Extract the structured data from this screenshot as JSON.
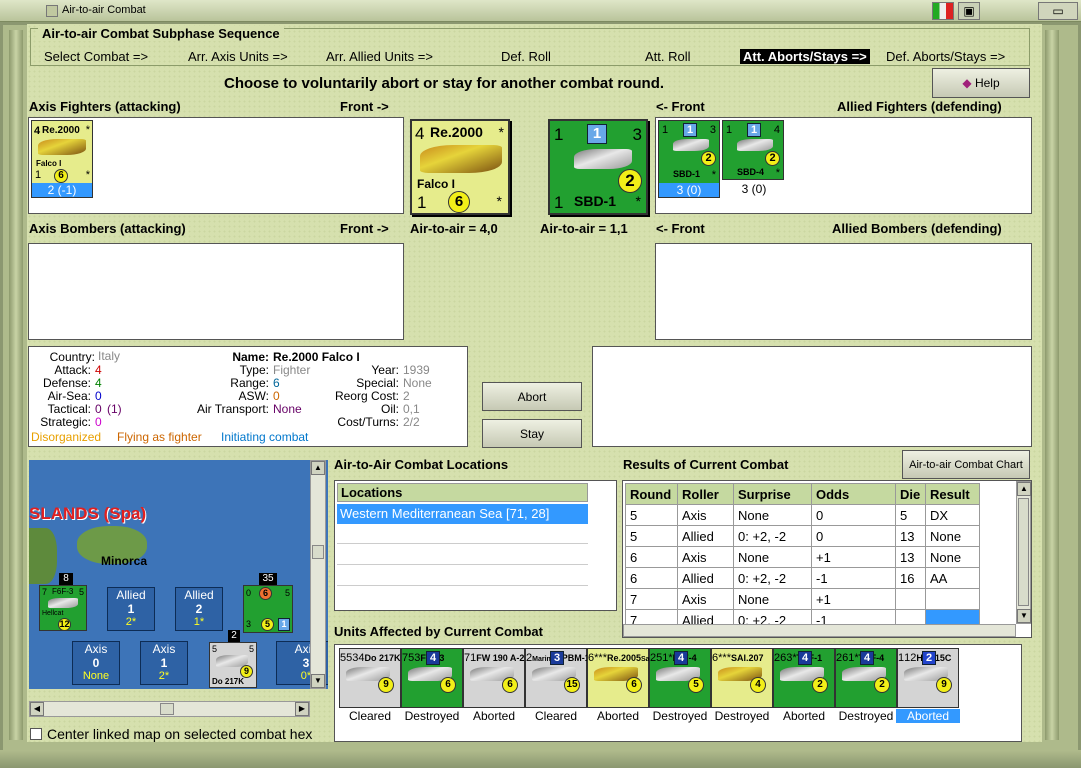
{
  "window": {
    "title": "Air-to-air Combat"
  },
  "sequence": {
    "title": "Air-to-air Combat Subphase Sequence",
    "steps": [
      "Select Combat =>",
      "Arr. Axis Units =>",
      "Arr. Allied Units =>",
      "Def. Roll",
      "Att. Roll",
      "Att. Aborts/Stays =>",
      "Def. Aborts/Stays =>"
    ],
    "active_index": 5
  },
  "instruction": "Choose to voluntarily abort or stay for another combat round.",
  "help_label": "Help",
  "sections": {
    "axis_fighters": "Axis Fighters (attacking)",
    "front_right": "Front ->",
    "front_left": "<- Front",
    "allied_fighters": "Allied Fighters (defending)",
    "axis_bombers": "Axis Bombers (attacking)",
    "allied_bombers": "Allied Bombers (defending)",
    "axis_a2a": "Air-to-air = 4,0",
    "allied_a2a": "Air-to-air = 1,1"
  },
  "axis_fighter_units": [
    {
      "name": "Re.2000",
      "sub": "Falco I",
      "atk": "4",
      "def": "1",
      "range": "6",
      "star": "*",
      "tag": "2 (-1)"
    }
  ],
  "allied_fighter_units": [
    {
      "name": "SBD-1",
      "top": "1",
      "blue": "1",
      "r": "3",
      "coin": "2",
      "tag": "3 (0)",
      "star": "*"
    },
    {
      "name": "SBD-4",
      "top": "1",
      "blue": "1",
      "r": "4",
      "coin": "2",
      "tag": "3 (0)",
      "star": "*"
    }
  ],
  "big_axis": {
    "atk": "4",
    "name": "Re.2000",
    "star": "*",
    "sub": "Falco I",
    "def": "1",
    "coin": "6",
    "star2": "*"
  },
  "big_allied": {
    "a": "1",
    "blue": "1",
    "b": "3",
    "coin": "2",
    "def": "1",
    "name": "SBD-1",
    "star": "*"
  },
  "info": {
    "country_l": "Country:",
    "country": "Italy",
    "attack_l": "Attack:",
    "attack": "4",
    "defense_l": "Defense:",
    "defense": "4",
    "airsea_l": "Air-Sea:",
    "airsea": "0",
    "tactical_l": "Tactical:",
    "tactical": "0",
    "tactical2": "(1)",
    "strategic_l": "Strategic:",
    "strategic": "0",
    "name_l": "Name:",
    "name": "Re.2000 Falco I",
    "type_l": "Type:",
    "type": "Fighter",
    "range_l": "Range:",
    "range": "6",
    "asw_l": "ASW:",
    "asw": "0",
    "airtrans_l": "Air Transport:",
    "airtrans": "None",
    "year_l": "Year:",
    "year": "1939",
    "special_l": "Special:",
    "special": "None",
    "reorg_l": "Reorg Cost:",
    "reorg": "2",
    "oil_l": "Oil:",
    "oil": "0,1",
    "cost_l": "Cost/Turns:",
    "cost": "2/2",
    "status1": "Disorganized",
    "status2": "Flying as fighter",
    "status3": "Initiating combat"
  },
  "buttons": {
    "abort": "Abort",
    "stay": "Stay",
    "chart": "Air-to-air Combat Chart"
  },
  "locations": {
    "title": "Air-to-Air Combat Locations",
    "header": "Locations",
    "items": [
      "Western Mediterranean Sea [71, 28]"
    ]
  },
  "results": {
    "title": "Results of Current Combat",
    "columns": [
      "Round",
      "Roller",
      "Surprise",
      "Odds",
      "Die",
      "Result"
    ],
    "rows": [
      [
        "5",
        "Axis",
        "None",
        "0",
        "5",
        "DX"
      ],
      [
        "5",
        "Allied",
        "0: +2, -2",
        "0",
        "13",
        "None"
      ],
      [
        "6",
        "Axis",
        "None",
        "+1",
        "13",
        "None"
      ],
      [
        "6",
        "Allied",
        "0: +2, -2",
        "-1",
        "16",
        "AA"
      ],
      [
        "7",
        "Axis",
        "None",
        "+1",
        "",
        ""
      ],
      [
        "7",
        "Allied",
        "0: +2, -2",
        "-1",
        "",
        ""
      ]
    ]
  },
  "map": {
    "region": "SLANDS (Spa)",
    "city": "Minorca",
    "cells": [
      {
        "side": "Allied",
        "n": "1",
        "v": "2*"
      },
      {
        "side": "Allied",
        "n": "2",
        "v": "1*"
      },
      {
        "side": "Axis",
        "n": "0",
        "v": "None"
      },
      {
        "side": "Axis",
        "n": "1",
        "v": "2*"
      },
      {
        "side": "Axis",
        "n": "3",
        "v": "0*"
      }
    ],
    "stack_counts": [
      "8",
      "35",
      "2"
    ],
    "unit_labels": [
      "F6F-3",
      "Hellcat",
      "Do 217K"
    ],
    "unit_nums": [
      "7",
      "5",
      "12",
      "5",
      "9",
      "0",
      "6",
      "5",
      "1",
      "3",
      "2",
      "5"
    ],
    "center_label": "Center linked map on selected combat hex"
  },
  "affected": {
    "title": "Units Affected by Current Combat",
    "units": [
      {
        "name": "Do 217K",
        "tl": "5",
        "tr": "5",
        "bl": "3",
        "br": "4",
        "coin": "9",
        "status": "Cleared",
        "color": "grey"
      },
      {
        "name": "F6F-3",
        "tl": "7",
        "tr": "5",
        "bl": "3",
        "br": "",
        "coin": "6",
        "blue": "4",
        "status": "Destroyed",
        "color": "green"
      },
      {
        "name": "FW 190 A-2",
        "tl": "7",
        "tr": "",
        "bl": "1",
        "br": "",
        "coin": "6",
        "status": "Aborted",
        "color": "grey"
      },
      {
        "name": "PBM-1",
        "tl": "2",
        "tr": "",
        "bl": "*",
        "br": "",
        "coin": "15",
        "blue": "3",
        "top": "Mariner",
        "status": "Cleared",
        "color": "grey"
      },
      {
        "name": "Re.2005",
        "tl": "6",
        "tr": "*",
        "bl": "*",
        "br": "*",
        "coin": "6",
        "sub": "Sagittario",
        "status": "Aborted",
        "color": "yellow"
      },
      {
        "name": "F4F-4",
        "tl": "2",
        "tr": "5",
        "bl": "1",
        "br": "*",
        "coin": "5",
        "blue": "4",
        "status": "Destroyed",
        "color": "green"
      },
      {
        "name": "SAI.207",
        "tl": "6",
        "tr": "*",
        "bl": "*",
        "br": "*",
        "coin": "4",
        "status": "Destroyed",
        "color": "yellow"
      },
      {
        "name": "TBF-1",
        "tl": "2",
        "tr": "6",
        "bl": "3",
        "br": "*",
        "coin": "2",
        "blue": "4",
        "status": "Aborted",
        "color": "green"
      },
      {
        "name": "TBF-4",
        "tl": "2",
        "tr": "6",
        "bl": "1",
        "br": "*",
        "coin": "2",
        "blue": "4",
        "status": "Destroyed",
        "color": "green"
      },
      {
        "name": "He 115C",
        "tl": "1",
        "tr": "",
        "bl": "1",
        "br": "2",
        "coin": "9",
        "blue": "2",
        "status": "Aborted",
        "color": "grey"
      }
    ]
  },
  "colors": {
    "attack": "#cc0000",
    "defense": "#008000",
    "airsea": "#0000cc",
    "tactical": "#660066",
    "strategic": "#cc00cc",
    "range": "#006699",
    "asw": "#cc6600",
    "disorganized": "#e8a000",
    "flying": "#cc6600",
    "initiating": "#0077cc"
  }
}
